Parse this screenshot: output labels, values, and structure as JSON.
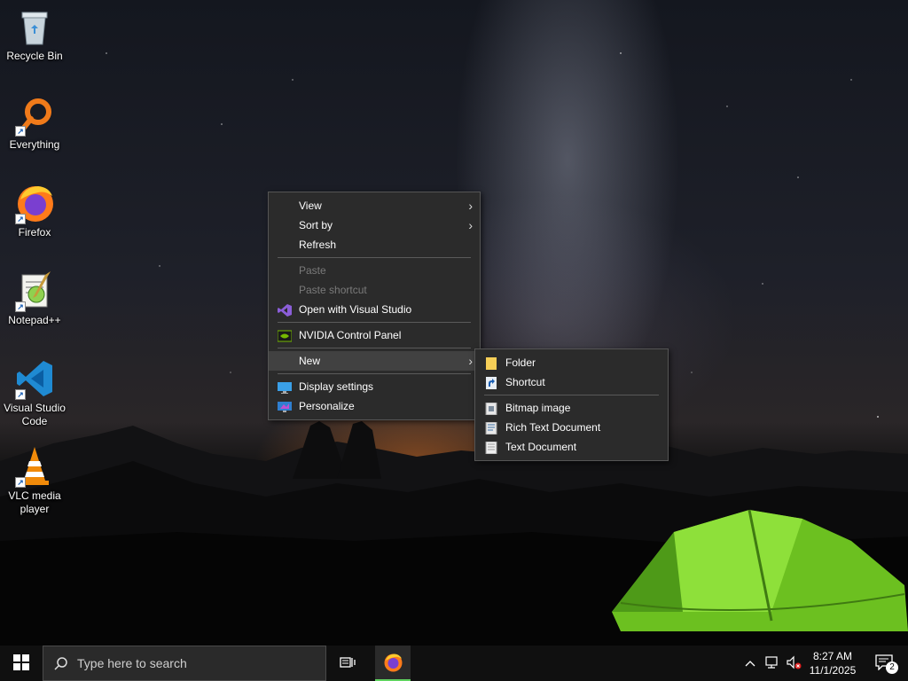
{
  "desktop": {
    "icons": [
      {
        "label": "Recycle Bin",
        "icon": "recycle-bin-icon"
      },
      {
        "label": "Everything",
        "icon": "everything-search-icon"
      },
      {
        "label": "Firefox",
        "icon": "firefox-icon"
      },
      {
        "label": "Notepad++",
        "icon": "notepad-plus-plus-icon"
      },
      {
        "label": "Visual Studio Code",
        "icon": "vscode-icon"
      },
      {
        "label": "VLC media player",
        "icon": "vlc-icon"
      }
    ]
  },
  "context_menu": {
    "items": [
      {
        "label": "View",
        "has_submenu": true
      },
      {
        "label": "Sort by",
        "has_submenu": true
      },
      {
        "label": "Refresh"
      },
      {
        "label": "Paste",
        "disabled": true
      },
      {
        "label": "Paste shortcut",
        "disabled": true
      },
      {
        "label": "Open with Visual Studio",
        "icon": "visual-studio-icon"
      },
      {
        "label": "NVIDIA Control Panel",
        "icon": "nvidia-icon"
      },
      {
        "label": "New",
        "has_submenu": true,
        "highlighted": true
      },
      {
        "label": "Display settings",
        "icon": "display-icon"
      },
      {
        "label": "Personalize",
        "icon": "personalize-icon"
      }
    ]
  },
  "new_submenu": {
    "items": [
      {
        "label": "Folder",
        "icon": "folder-icon"
      },
      {
        "label": "Shortcut",
        "icon": "shortcut-icon"
      },
      {
        "label": "Bitmap image",
        "icon": "bitmap-icon"
      },
      {
        "label": "Rich Text Document",
        "icon": "rich-text-icon"
      },
      {
        "label": "Text Document",
        "icon": "text-document-icon"
      }
    ]
  },
  "taskbar": {
    "search_placeholder": "Type here to search",
    "clock_time": "8:27 AM",
    "clock_date": "11/1/2025",
    "notification_count": "2"
  },
  "colors": {
    "menu_bg": "#2b2b2b",
    "menu_highlight": "#414141",
    "taskbar_bg": "#101010",
    "firefox_active_underline": "#5fd35f",
    "tent_green": "#7ed321"
  }
}
